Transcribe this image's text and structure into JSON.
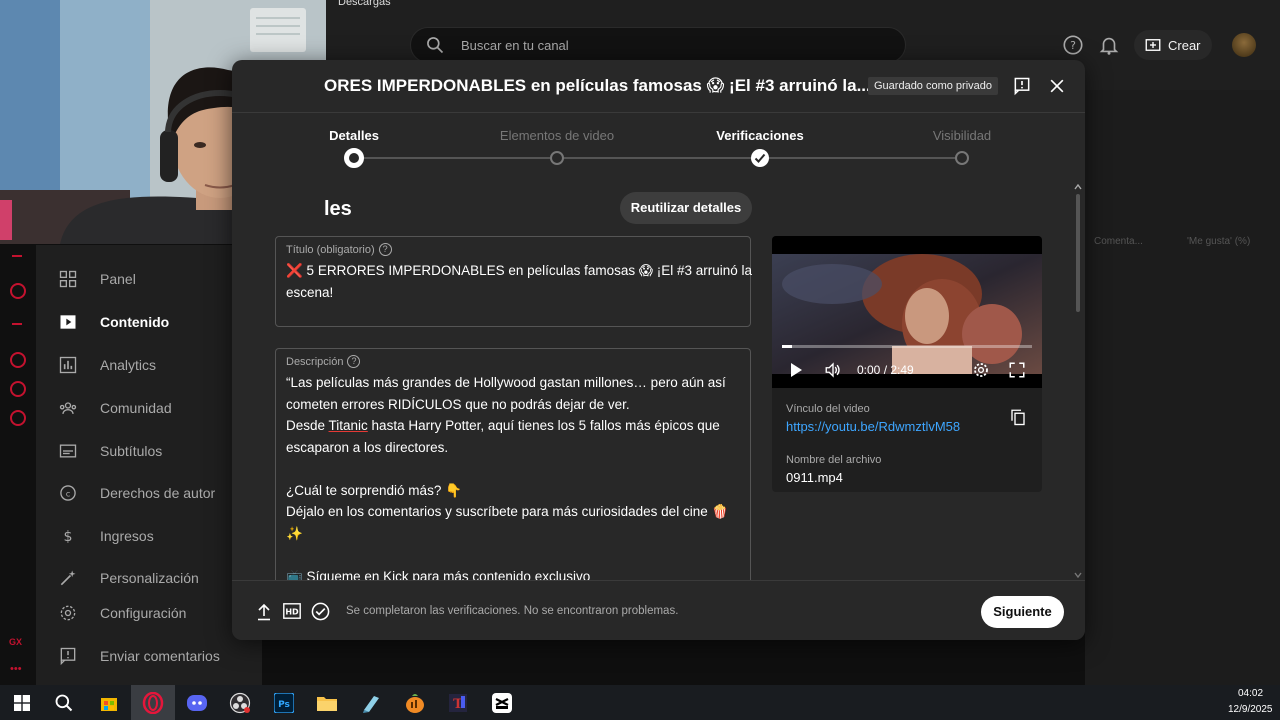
{
  "browser": {
    "downloads_label": "Descargas"
  },
  "header": {
    "search_placeholder": "Buscar en tu canal",
    "create_label": "Crear"
  },
  "sidebar": {
    "items": [
      {
        "label": "Panel",
        "icon": "dashboard-icon"
      },
      {
        "label": "Contenido",
        "icon": "content-icon",
        "active": true
      },
      {
        "label": "Analytics",
        "icon": "analytics-icon"
      },
      {
        "label": "Comunidad",
        "icon": "community-icon"
      },
      {
        "label": "Subtítulos",
        "icon": "subtitles-icon"
      },
      {
        "label": "Derechos de autor",
        "icon": "copyright-icon"
      },
      {
        "label": "Ingresos",
        "icon": "earn-icon"
      },
      {
        "label": "Personalización",
        "icon": "customization-icon"
      },
      {
        "label": "Configuración",
        "icon": "settings-icon"
      },
      {
        "label": "Enviar comentarios",
        "icon": "feedback-icon"
      }
    ]
  },
  "background_table": {
    "col1": "Comenta...",
    "col2": "'Me gusta' (%)"
  },
  "modal": {
    "title": "ORES IMPERDONABLES en películas famosas 😱 ¡El #3 arruinó la...",
    "saved_badge": "Guardado como privado",
    "steps": [
      {
        "label": "Detalles",
        "state": "current"
      },
      {
        "label": "Elementos de video",
        "state": "pending"
      },
      {
        "label": "Verificaciones",
        "state": "done"
      },
      {
        "label": "Visibilidad",
        "state": "pending"
      }
    ],
    "section_heading": "les",
    "reuse_button": "Reutilizar detalles",
    "title_field": {
      "label": "Título (obligatorio)",
      "value_line1": "❌ 5 ERRORES IMPERDONABLES en películas famosas 😱 ¡El #3 arruinó la",
      "value_line2": "escena!"
    },
    "description_field": {
      "label": "Descripción",
      "lines": [
        "“Las películas más grandes de Hollywood gastan millones… pero aún así",
        "cometen errores RIDÍCULOS que no podrás dejar de ver.",
        "Desde |Titanic| hasta Harry Potter, aquí tienes los 5 fallos más épicos que",
        "escaparon a los directores.",
        "",
        "¿Cuál te sorprendió más? 👇",
        "Déjalo en los comentarios y suscríbete para más curiosidades del cine 🍿",
        "✨",
        "",
        "📺 Sígueme en Kick para más contenido exclusivo"
      ]
    },
    "video": {
      "progress_fraction": 0.04,
      "time": "0:00 / 2:49",
      "link_label": "Vínculo del video",
      "link_url": "https://youtu.be/RdwmztlvM58",
      "filename_label": "Nombre del archivo",
      "filename": "0911.mp4"
    },
    "footer": {
      "status": "Se completaron las verificaciones. No se encontraron problemas.",
      "next_button": "Siguiente"
    }
  },
  "taskbar": {
    "apps": [
      "windows-start-icon",
      "search-icon",
      "store-icon",
      "opera-gx-icon",
      "discord-icon",
      "obs-icon",
      "photoshop-icon",
      "file-explorer-icon",
      "notepad-icon",
      "fl-studio-icon",
      "text-editor-icon",
      "capcut-icon"
    ],
    "time": "04:02",
    "date": "12/9/2025"
  },
  "colors": {
    "accent_link": "#3ea6ff",
    "rail_red": "#c4122f",
    "modal_bg": "#282828"
  }
}
